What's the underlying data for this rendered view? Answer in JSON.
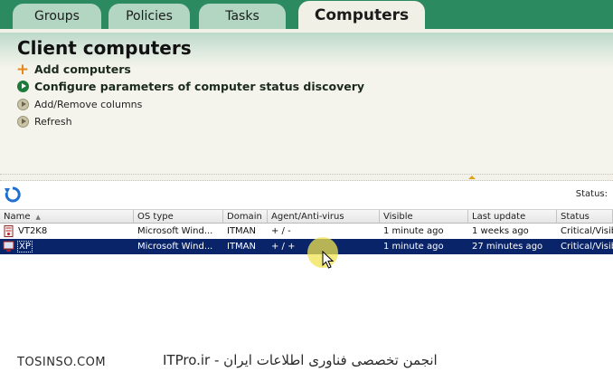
{
  "tabs": {
    "groups": "Groups",
    "policies": "Policies",
    "tasks": "Tasks",
    "computers": "Computers"
  },
  "header": {
    "title": "Client computers",
    "actions": {
      "add": "Add computers",
      "configure": "Configure parameters of computer status discovery",
      "columns": "Add/Remove columns",
      "refresh": "Refresh"
    }
  },
  "toolbar": {
    "status_label": "Status:"
  },
  "table": {
    "columns": [
      "Name",
      "OS type",
      "Domain",
      "Agent/Anti-virus",
      "Visible",
      "Last update",
      "Status"
    ],
    "rows": [
      {
        "name": "VT2K8",
        "os": "Microsoft Wind...",
        "domain": "ITMAN",
        "agent": "+ / -",
        "visible": "1 minute ago",
        "last_update": "1 weeks ago",
        "status": "Critical/Visible"
      },
      {
        "name": "XP",
        "os": "Microsoft Wind...",
        "domain": "ITMAN",
        "agent": "+ / +",
        "visible": "1 minute ago",
        "last_update": "27 minutes ago",
        "status": "Critical/Visible"
      }
    ]
  },
  "watermark": {
    "left": "TOSINSO.COM",
    "right": "ITPro.ir - انجمن تخصصی فناوری اطلاعات ایران"
  },
  "colors": {
    "tab_bar": "#2c8a60",
    "selection": "#0a246a",
    "accent_orange": "#e8871a"
  }
}
